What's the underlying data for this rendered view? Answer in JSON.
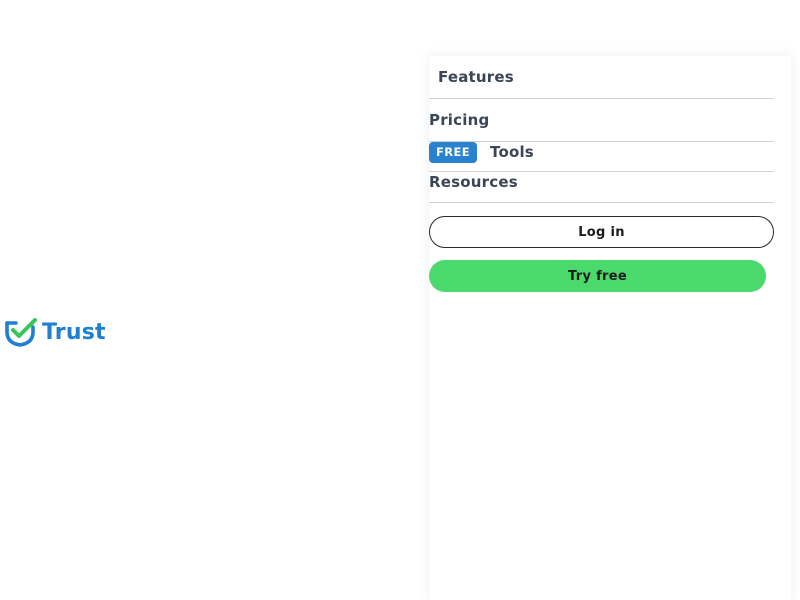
{
  "brand": {
    "name": "Trust",
    "colors": {
      "logo_blue": "#1f7fd0",
      "check_green": "#35c759"
    }
  },
  "menu": {
    "items": [
      {
        "label": "Features"
      },
      {
        "label": "Pricing"
      },
      {
        "label": "Tools",
        "badge": "FREE"
      },
      {
        "label": "Resources"
      }
    ]
  },
  "actions": {
    "login_label": "Log in",
    "try_label": "Try free"
  },
  "colors": {
    "menu_text": "#3a4656",
    "badge_bg": "#2a82cf",
    "try_button_bg": "#4ad96b",
    "divider": "#cdd2d8"
  }
}
